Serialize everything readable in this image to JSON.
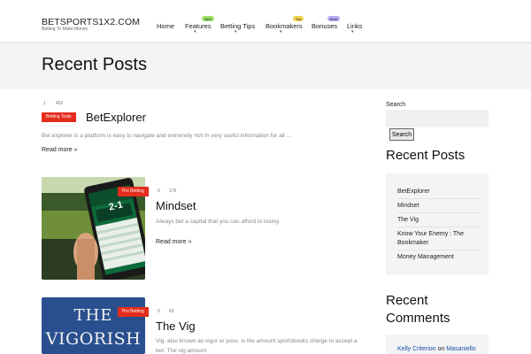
{
  "header": {
    "logo": "BETSPORTS1X2.COM",
    "tagline": "Betting To Make Money",
    "nav": [
      {
        "label": "Home",
        "badge": "",
        "caret": false
      },
      {
        "label": "Features",
        "badge": "New",
        "caret": true
      },
      {
        "label": "Betting Tips",
        "badge": "",
        "caret": true
      },
      {
        "label": "Bookmakers",
        "badge": "Top",
        "caret": true
      },
      {
        "label": "Bonuses",
        "badge": "Best",
        "caret": false
      },
      {
        "label": "Links",
        "badge": "",
        "caret": true
      }
    ],
    "caret_glyph": "▾",
    "badge_colors": {
      "New": "#9ee06a",
      "Top": "#f3d24a",
      "Best": "#b9a9f5"
    }
  },
  "page_title": "Recent Posts",
  "posts": [
    {
      "comments": "1",
      "views": "452",
      "category": "Betting Tools",
      "title": "BetExplorer",
      "excerpt": "Bet explorer is a platform is easy to navigate and extremely rich in very useful information for all ...",
      "read_more": "Read more »"
    },
    {
      "comments": "0",
      "views": "176",
      "category": "Pro Betting",
      "title": "Mindset",
      "excerpt": "Always bet a capital that you can afford to losing",
      "read_more": "Read more »",
      "thumb_score": "2-1"
    },
    {
      "comments": "0",
      "views": "82",
      "category": "Pro Betting",
      "title": "The Vig",
      "excerpt_line1": "Vig, also known as vigor or juice, is the amount sportsbooks charge to accept a",
      "excerpt_line2": "bet. The vig amount",
      "thumb_line1": "THE",
      "thumb_line2": "VIGORISH"
    }
  ],
  "sidebar": {
    "search_label": "Search",
    "search_placeholder": "",
    "search_button": "Search",
    "recent_title": "Recent Posts",
    "recent_items": [
      "BetExplorer",
      "Mindset",
      "The Vig",
      "Know Your Enemy : The Bookmaker",
      "Money Management"
    ],
    "comments_title_1": "Recent",
    "comments_title_2": "Comments",
    "comment_author": "Kelly Criterion",
    "comment_on": "on",
    "comment_post": "Masaniello"
  },
  "colors": {
    "accent_red": "#e52d1d",
    "link_blue": "#1a4fa3"
  }
}
